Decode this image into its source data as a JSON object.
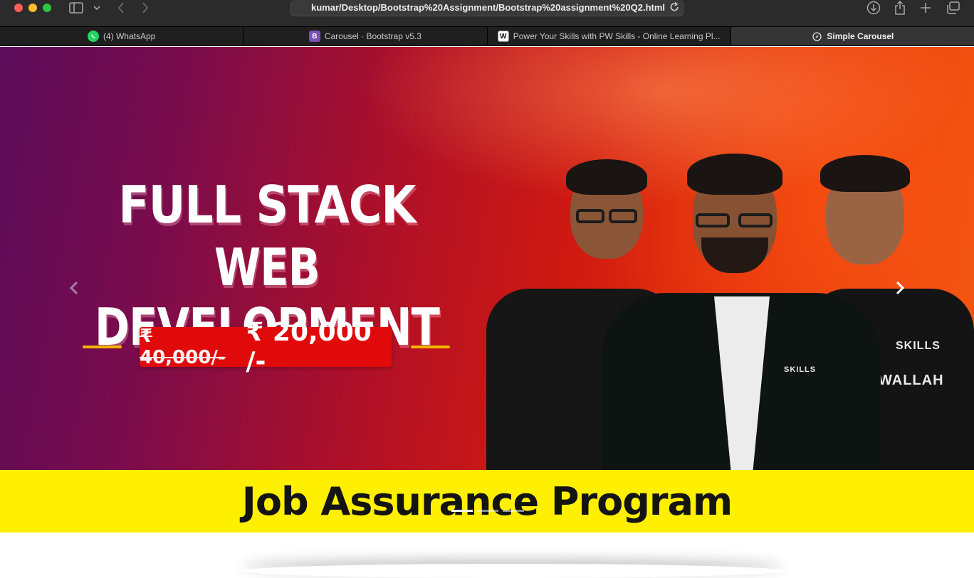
{
  "browser": {
    "url": "kumar/Desktop/Bootstrap%20Assignment/Bootstrap%20assignment%20Q2.html",
    "tabs": [
      {
        "label": "(4) WhatsApp",
        "icon": "whatsapp-icon",
        "active": false
      },
      {
        "label": "Carousel · Bootstrap v5.3",
        "icon": "bootstrap-icon",
        "active": false
      },
      {
        "label": "Power Your Skills with PW Skills - Online Learning Pl...",
        "icon": "pw-skills-icon",
        "active": false
      },
      {
        "label": "Simple Carousel",
        "icon": "compass-icon",
        "active": true
      }
    ]
  },
  "carousel": {
    "slide": {
      "headline_line1": "FULL STACK",
      "headline_line2": "WEB DEVELOPMENT",
      "old_price": "₹ 40,000/-",
      "new_price": "₹ 20,000 /-",
      "band_text": "Job Assurance Program",
      "logo_text_center": "SKILLS",
      "logo_text_right": "SKILLS",
      "shirt_text_right": "WALLAH"
    },
    "indicator_count": 3,
    "active_indicator": 0
  },
  "colors": {
    "price_box": "#e10a0a",
    "band": "#ffef00",
    "accent_line": "#f2b600"
  }
}
